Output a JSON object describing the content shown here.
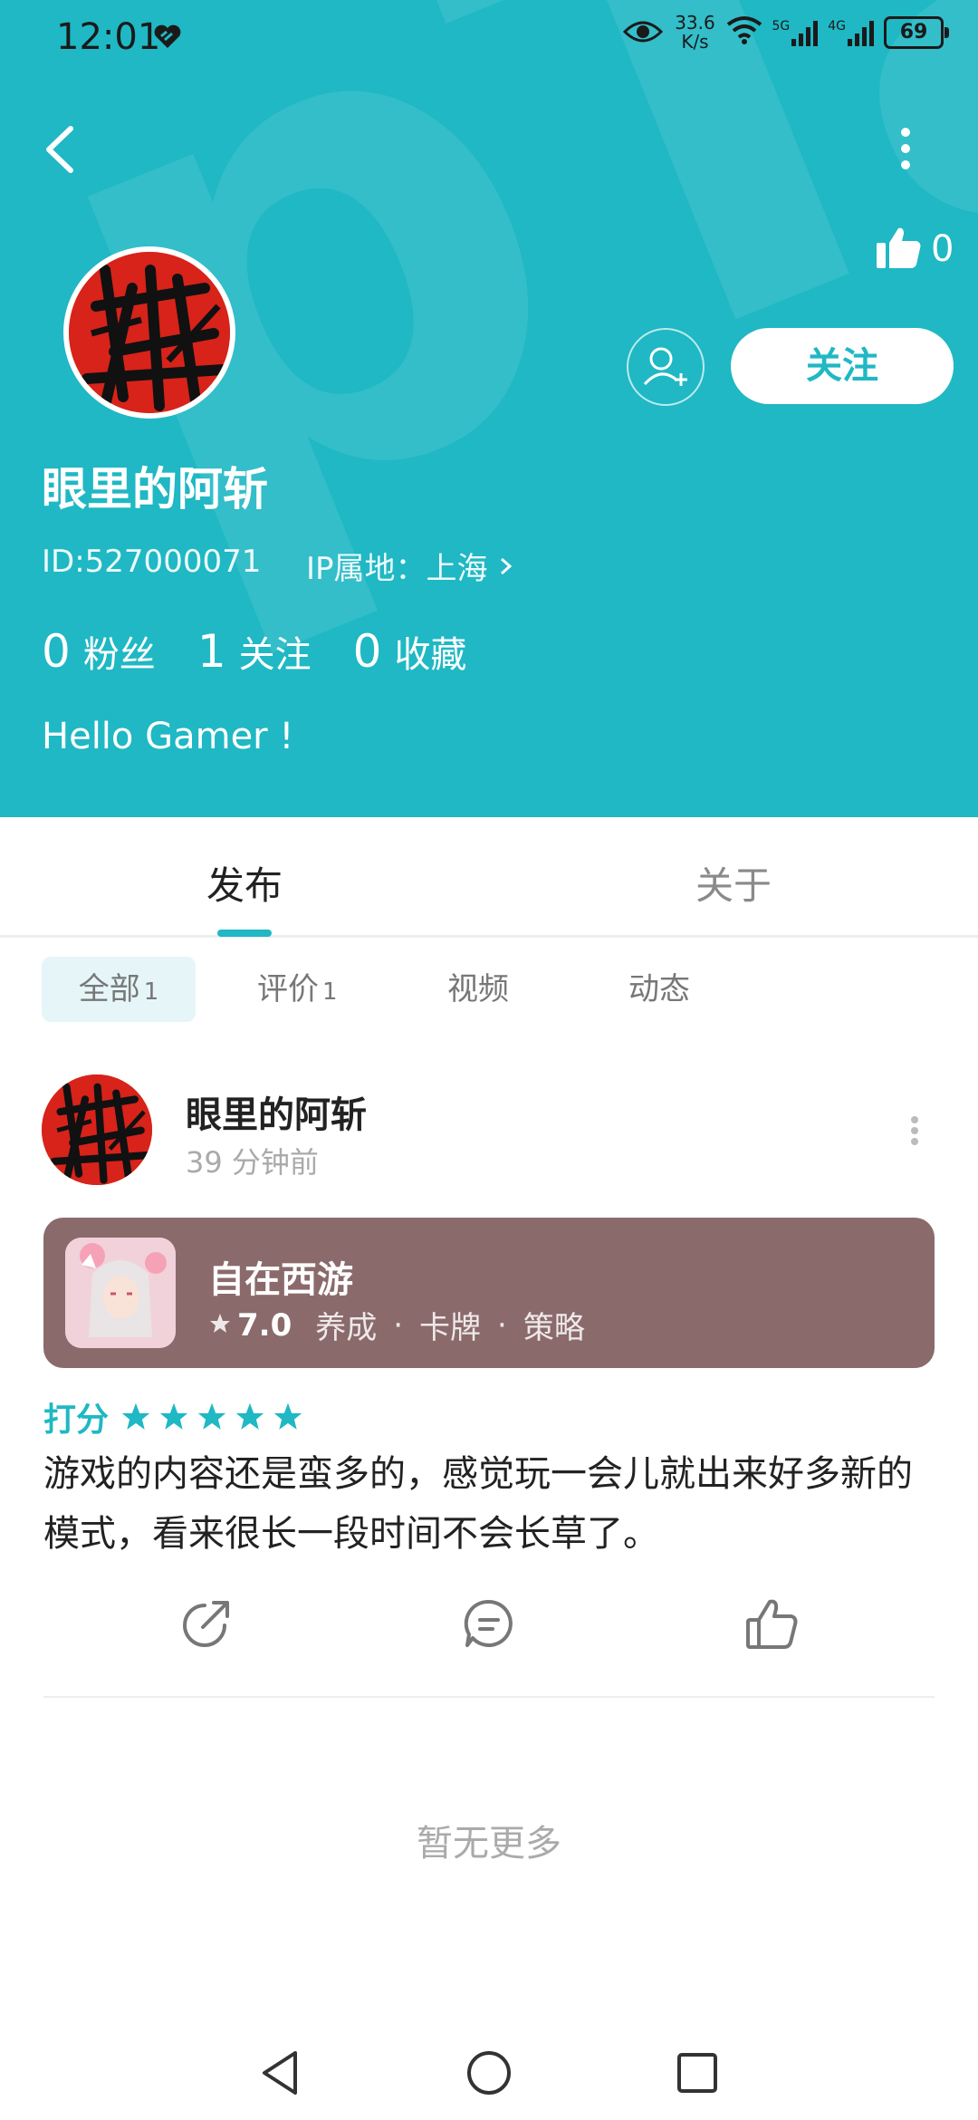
{
  "status_bar": {
    "time": "12:01",
    "net_speed_value": "33.6",
    "net_speed_unit": "K/s",
    "signal_5g": "5G",
    "signal_4g": "4G",
    "battery": "69"
  },
  "profile": {
    "likes": "0",
    "follow_label": "关注",
    "username": "眼里的阿斩",
    "id_text": "ID:527000071",
    "ip_text": "IP属地：上海",
    "stats": [
      {
        "value": "0",
        "label": "粉丝"
      },
      {
        "value": "1",
        "label": "关注"
      },
      {
        "value": "0",
        "label": "收藏"
      }
    ],
    "bio": "Hello Gamer !"
  },
  "tabs": {
    "publish": "发布",
    "about": "关于"
  },
  "filter_chips": {
    "all": {
      "label": "全部",
      "count": "1"
    },
    "review": {
      "label": "评价",
      "count": "1"
    },
    "video": {
      "label": "视频"
    },
    "moment": {
      "label": "动态"
    }
  },
  "post": {
    "author": "眼里的阿斩",
    "time": "39 分钟前",
    "game": {
      "name": "自在西游",
      "score": "7.0",
      "tags": [
        "养成",
        "卡牌",
        "策略"
      ]
    },
    "rating_label": "打分",
    "rating_stars": 5,
    "text": "游戏的内容还是蛮多的，感觉玩一会儿就出来好多新的模式，看来很长一段时间不会长草了。"
  },
  "footer": {
    "no_more": "暂无更多"
  },
  "colors": {
    "accent": "#1fb8c4",
    "card_bg": "#8b6a6b",
    "avatar_red": "#d7231a"
  }
}
